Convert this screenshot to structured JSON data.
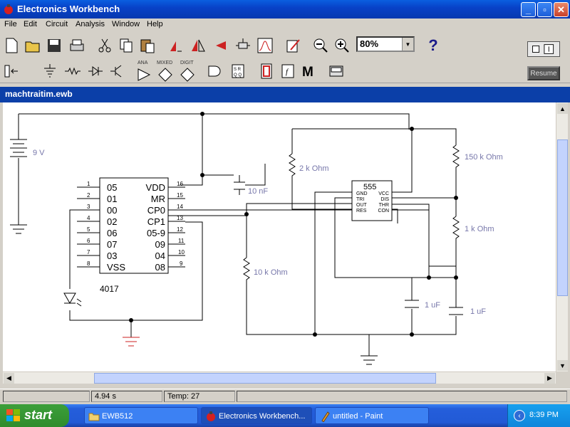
{
  "window": {
    "title": "Electronics Workbench",
    "buttons": {
      "minimize": "_",
      "maximize": "▫",
      "close": "✕"
    }
  },
  "menu": [
    "File",
    "Edit",
    "Circuit",
    "Analysis",
    "Window",
    "Help"
  ],
  "toolbar": {
    "zoom_value": "80%",
    "help_label": "?",
    "resume_label": "Resume",
    "parts_labels": [
      "ANA",
      "MIXED",
      "DIGIT"
    ],
    "icons": [
      "new-file-icon",
      "open-folder-icon",
      "save-icon",
      "print-icon",
      "cut-icon",
      "copy-icon",
      "paste-icon",
      "rotate-icon",
      "flip-horizontal-icon",
      "flip-vertical-icon",
      "subcircuit-icon",
      "graph-icon",
      "component-properties-icon",
      "zoom-out-icon",
      "zoom-in-icon"
    ],
    "palette_icons": [
      "favorites-bin-icon",
      "sources-icon",
      "basic-icon",
      "diodes-icon",
      "transistors-icon",
      "analog-ics-icon",
      "mixed-ics-icon",
      "digital-ics-icon",
      "logic-gates-icon",
      "digital-icon",
      "indicators-icon",
      "controls-icon",
      "miscellaneous-icon",
      "instruments-icon"
    ]
  },
  "document": {
    "title": "machtraitim.ewb"
  },
  "schematic": {
    "battery_label": "9 V",
    "ic4017": {
      "name": "4017",
      "left_pins": [
        {
          "num": "1",
          "label": "05"
        },
        {
          "num": "2",
          "label": "01"
        },
        {
          "num": "3",
          "label": "00"
        },
        {
          "num": "4",
          "label": "02"
        },
        {
          "num": "5",
          "label": "06"
        },
        {
          "num": "6",
          "label": "07"
        },
        {
          "num": "7",
          "label": "03"
        },
        {
          "num": "8",
          "label": "VSS"
        }
      ],
      "right_pins": [
        {
          "num": "16",
          "label": "VDD"
        },
        {
          "num": "15",
          "label": "MR"
        },
        {
          "num": "14",
          "label": "CP0"
        },
        {
          "num": "13",
          "label": "CP1"
        },
        {
          "num": "12",
          "label": "05-9"
        },
        {
          "num": "11",
          "label": "09"
        },
        {
          "num": "10",
          "label": "04"
        },
        {
          "num": "9",
          "label": "08"
        }
      ]
    },
    "ic555": {
      "name": "555",
      "pins_left": [
        "GND",
        "TRI",
        "OUT",
        "RES"
      ],
      "pins_right": [
        "VCC",
        "DIS",
        "THR",
        "CON"
      ]
    },
    "labels": {
      "cap_10nf": "10 nF",
      "res_2k": "2 k Ohm",
      "res_150k": "150 k Ohm",
      "res_1k": "1 k Ohm",
      "res_10k": "10 k Ohm",
      "cap_1uf_a": "1 uF",
      "cap_1uf_b": "1 uF"
    }
  },
  "status": {
    "time": "4.94 s",
    "temp": "Temp:  27"
  },
  "taskbar": {
    "start_label": "start",
    "tasks": [
      {
        "label": "EWB512",
        "icon": "folder-icon"
      },
      {
        "label": "Electronics Workbench...",
        "icon": "ewb-app-icon"
      },
      {
        "label": "untitled - Paint",
        "icon": "paint-icon"
      }
    ],
    "clock": "8:39 PM"
  }
}
